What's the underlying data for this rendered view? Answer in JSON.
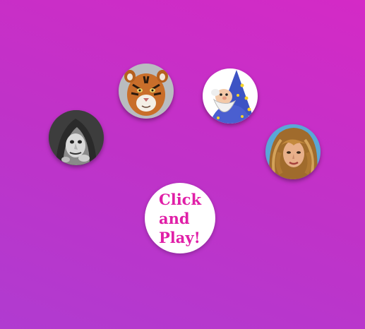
{
  "play_button": {
    "label": "Click and Play!"
  },
  "characters": [
    {
      "name": "witch",
      "icon": "witch-portrait-icon"
    },
    {
      "name": "tiger",
      "icon": "tiger-portrait-icon"
    },
    {
      "name": "wizard",
      "icon": "wizard-portrait-icon"
    },
    {
      "name": "girl",
      "icon": "girl-portrait-icon"
    }
  ],
  "colors": {
    "background_start": "#d42ac6",
    "background_end": "#b03bd0",
    "button_bg": "#ffffff",
    "button_text": "#e01fa7"
  }
}
